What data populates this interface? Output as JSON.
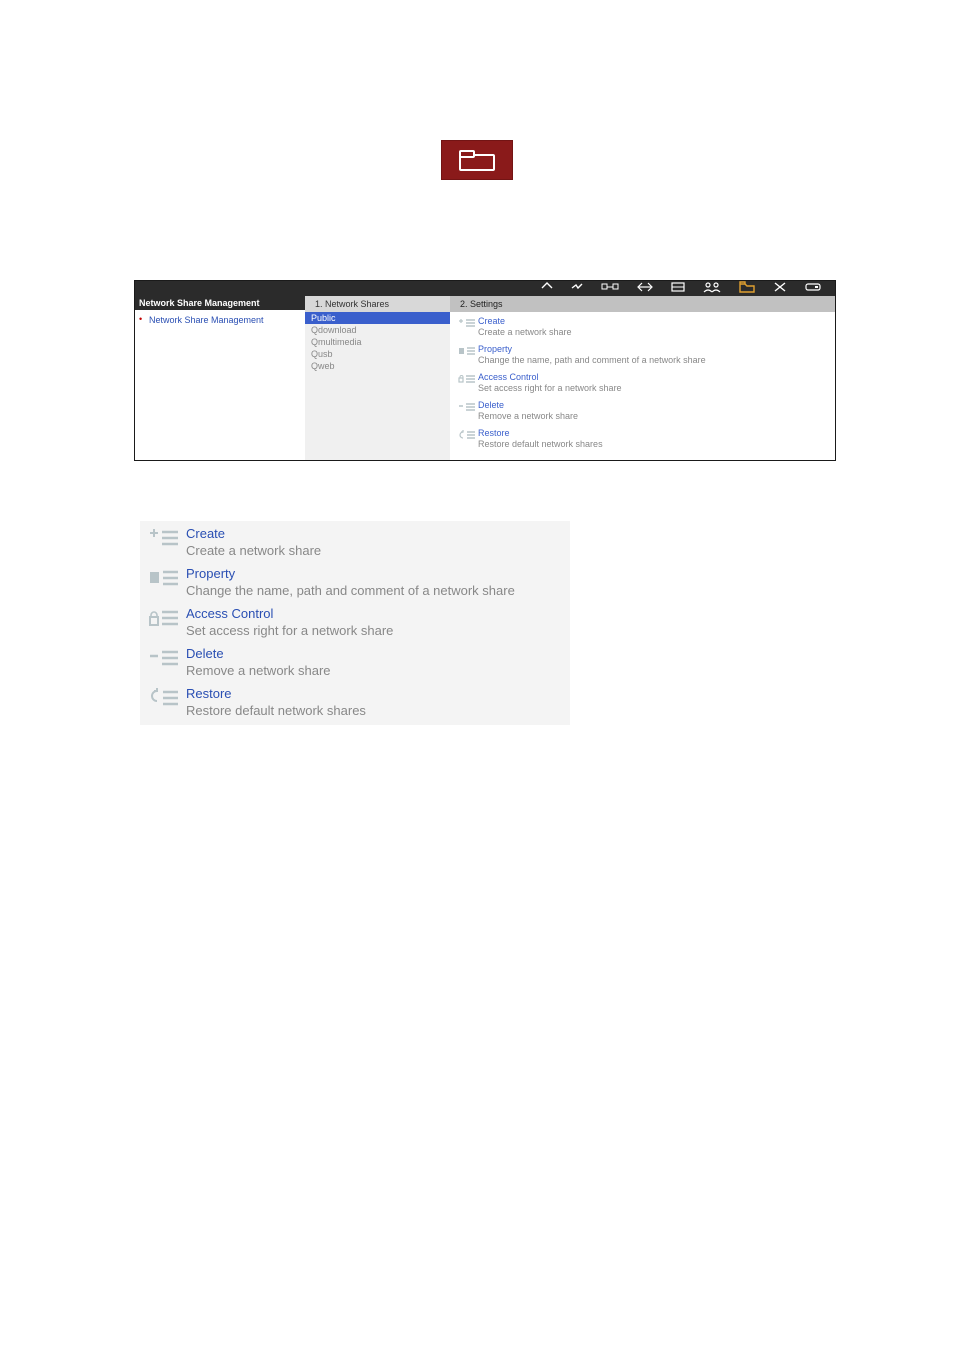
{
  "sidebar": {
    "title": "Network Share Management",
    "link": "Network Share Management"
  },
  "tabs": {
    "tab1": "1. Network Shares",
    "tab2": "2. Settings"
  },
  "shares": {
    "i0": "Public",
    "i1": "Qdownload",
    "i2": "Qmultimedia",
    "i3": "Qusb",
    "i4": "Qweb"
  },
  "actions": {
    "create": {
      "title": "Create",
      "sub": "Create a network share"
    },
    "property": {
      "title": "Property",
      "sub": "Change the name, path and comment of a network share"
    },
    "access": {
      "title": "Access Control",
      "sub": "Set access right for a network share"
    },
    "delete": {
      "title": "Delete",
      "sub": "Remove a network share"
    },
    "restore": {
      "title": "Restore",
      "sub": "Restore default network shares"
    }
  }
}
